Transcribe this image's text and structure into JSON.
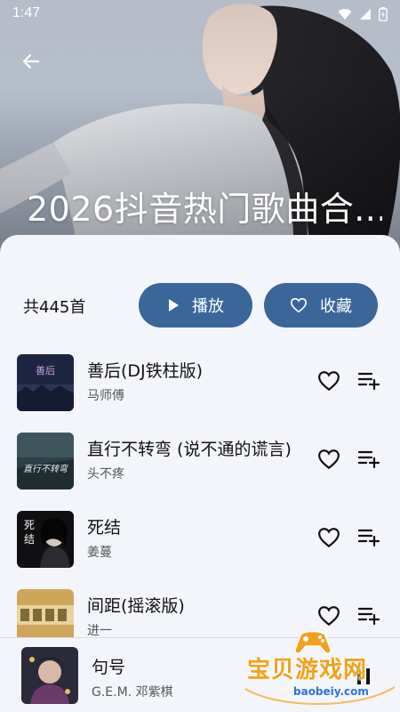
{
  "status": {
    "time": "1:47",
    "icons": [
      "wifi-icon",
      "signal-icon",
      "battery-icon"
    ]
  },
  "header": {
    "back_icon": "back-arrow-icon",
    "title": "2026抖音热门歌曲合..."
  },
  "summary": {
    "count_label": "共445首"
  },
  "actions": {
    "play_label": "播放",
    "play_icon": "play-icon",
    "fav_label": "收藏",
    "fav_icon": "heart-outline-icon"
  },
  "songs": [
    {
      "title": "善后(DJ铁柱版)",
      "artist": "马师傅"
    },
    {
      "title": "直行不转弯 (说不通的谎言)",
      "artist": "头不疼"
    },
    {
      "title": "死结",
      "artist": "姜蔓"
    },
    {
      "title": "间距(摇滚版)",
      "artist": "进一"
    }
  ],
  "now_playing": {
    "title": "句号",
    "artist": "G.E.M. 邓紫棋",
    "control_icon": "pause-icon"
  },
  "watermark": {
    "text": "宝贝游戏网",
    "url": "baobeiy.com"
  },
  "colors": {
    "accent": "#3a669a",
    "background": "#f3f5fb",
    "watermark_orange": "#f3a11a",
    "watermark_blue": "#2f73d8"
  }
}
